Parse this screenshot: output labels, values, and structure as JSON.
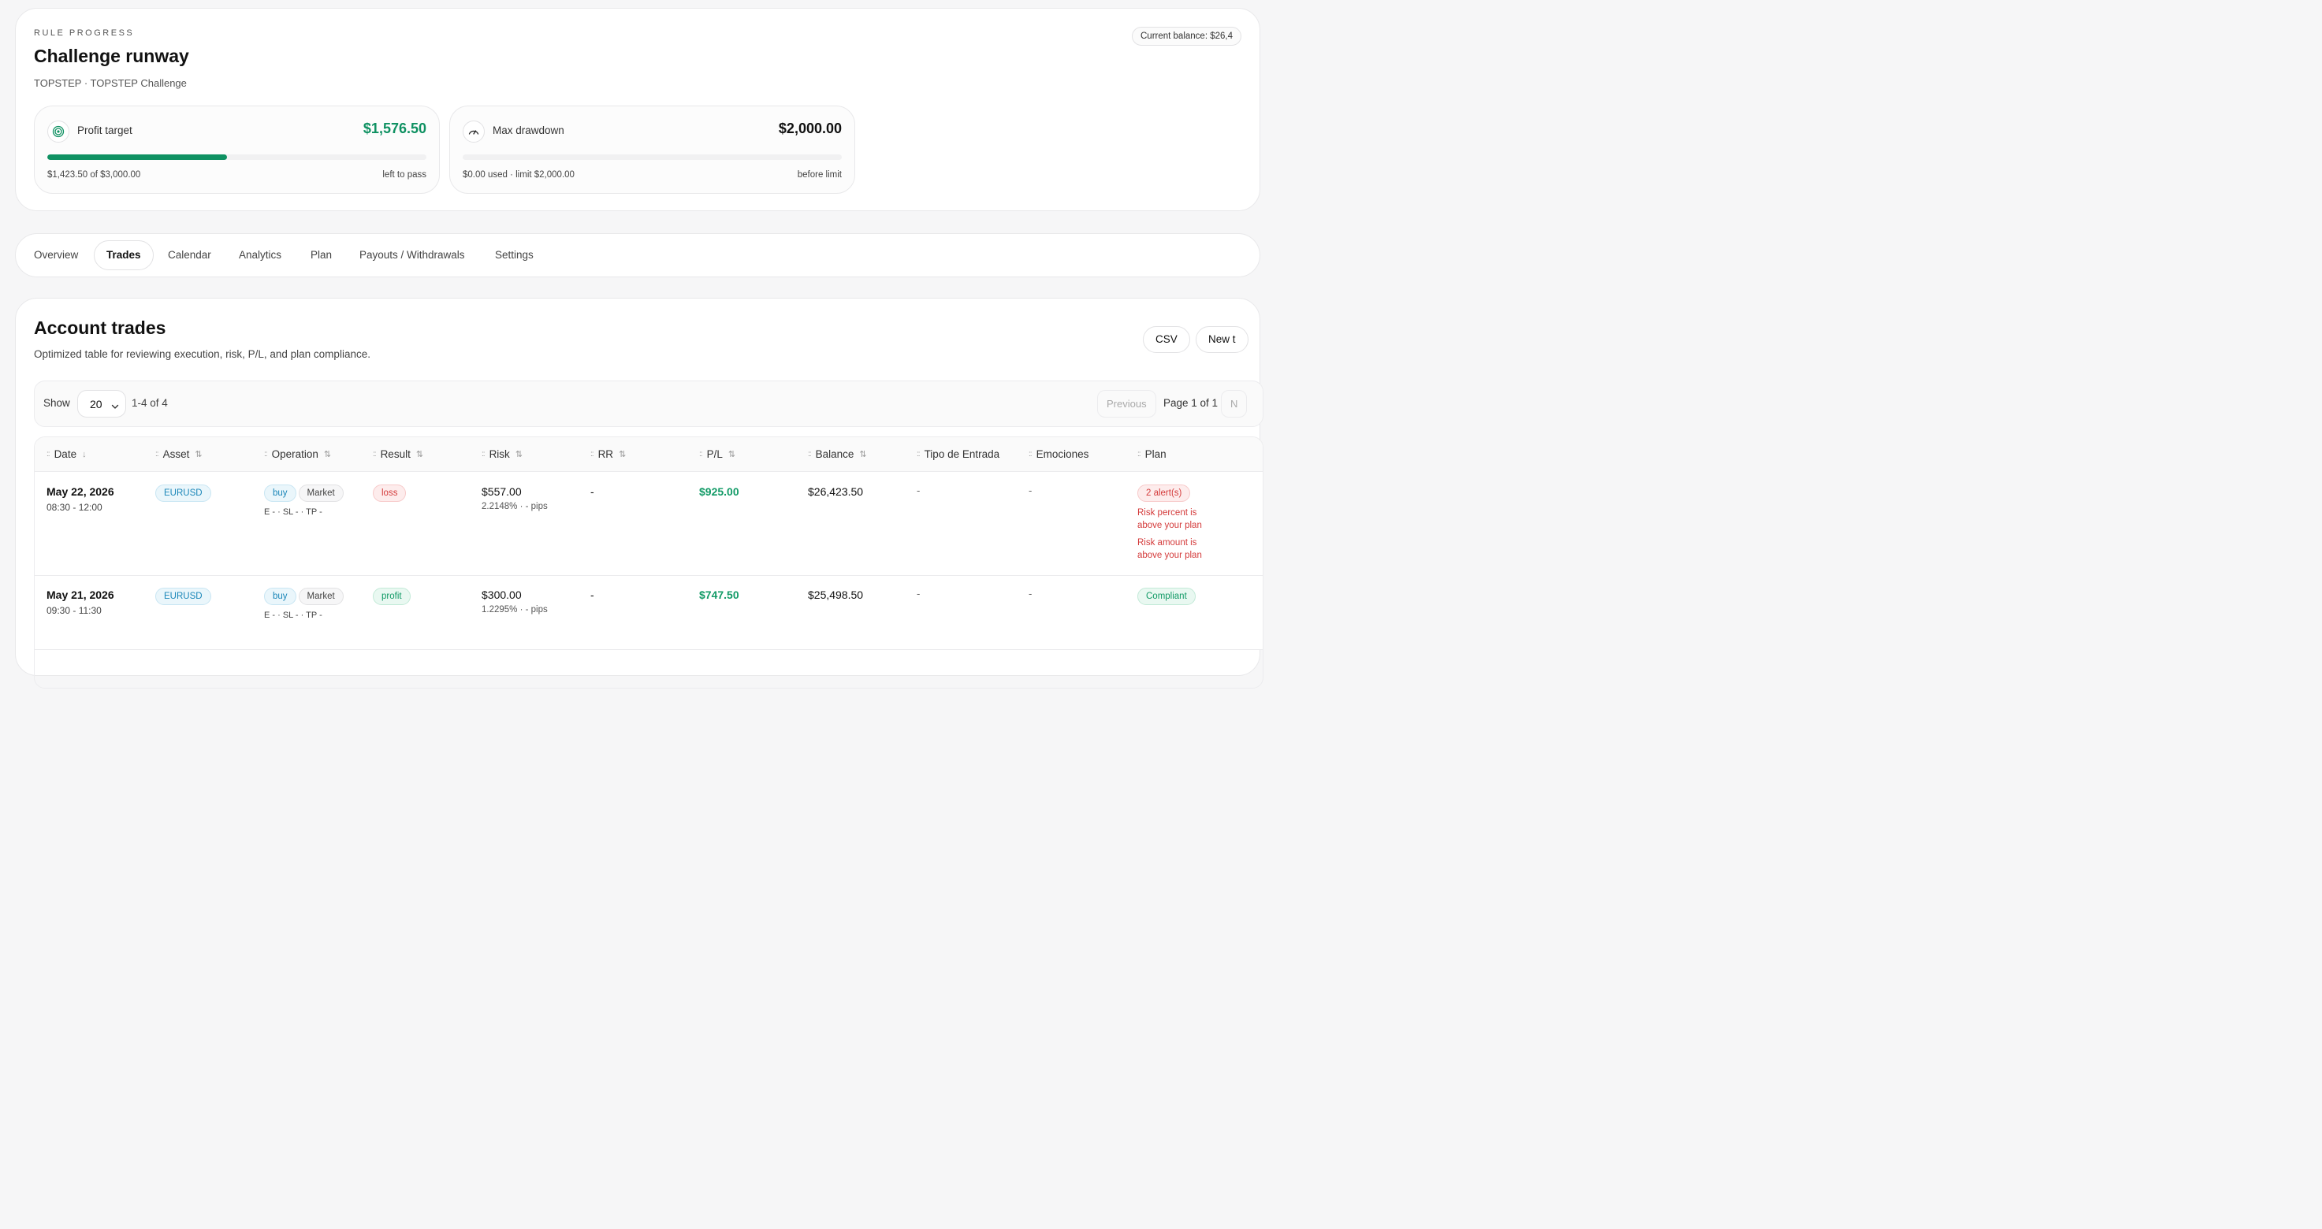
{
  "rule_progress": {
    "eyebrow": "RULE PROGRESS",
    "title": "Challenge runway",
    "subtitle": "TOPSTEP · TOPSTEP Challenge",
    "balance_pill": "Current balance: $26,4",
    "profit_target": {
      "label": "Profit target",
      "value": "$1,576.50",
      "progress": 0.4745,
      "footer_left": "$1,423.50 of $3,000.00",
      "footer_right": "left to pass",
      "icon": "target-icon",
      "color": "#0f9162"
    },
    "max_drawdown": {
      "label": "Max drawdown",
      "value": "$2,000.00",
      "progress": 0,
      "footer_left": "$0.00 used · limit $2,000.00",
      "footer_right": "before limit",
      "icon": "gauge-icon"
    }
  },
  "tabs": [
    {
      "label": "Overview",
      "active": false
    },
    {
      "label": "Trades",
      "active": true
    },
    {
      "label": "Calendar",
      "active": false
    },
    {
      "label": "Analytics",
      "active": false
    },
    {
      "label": "Plan",
      "active": false
    },
    {
      "label": "Payouts / Withdrawals",
      "active": false
    },
    {
      "label": "Settings",
      "active": false
    }
  ],
  "trades": {
    "title": "Account trades",
    "subtitle": "Optimized table for reviewing execution, risk, P/L, and plan compliance.",
    "csv_label": "CSV",
    "new_label": "New t",
    "toolbar": {
      "show_label": "Show",
      "page_size": "20",
      "range": "1-4 of 4",
      "previous": "Previous",
      "page_label": "Page 1 of 1",
      "next": "N"
    },
    "columns": {
      "date": "Date",
      "asset": "Asset",
      "operation": "Operation",
      "result": "Result",
      "risk": "Risk",
      "rr": "RR",
      "pl": "P/L",
      "balance": "Balance",
      "entry_type": "Tipo de Entrada",
      "emotions": "Emociones",
      "plan": "Plan"
    },
    "rows": [
      {
        "date": "May 22, 2026",
        "time": "08:30 - 12:00",
        "asset": "EURUSD",
        "side": "buy",
        "order_type": "Market",
        "levels": "E - · SL - · TP -",
        "result": "loss",
        "risk": "$557.00",
        "risk_detail": "2.2148% · - pips",
        "rr": "-",
        "pl": "$925.00",
        "balance": "$26,423.50",
        "entry_type": "-",
        "emotions": "-",
        "plan_badge": "2 alert(s)",
        "plan_alert_1": "Risk percent is above your plan",
        "plan_alert_2": "Risk amount is above your plan"
      },
      {
        "date": "May 21, 2026",
        "time": "09:30 - 11:30",
        "asset": "EURUSD",
        "side": "buy",
        "order_type": "Market",
        "levels": "E - · SL - · TP -",
        "result": "profit",
        "risk": "$300.00",
        "risk_detail": "1.2295% · - pips",
        "rr": "-",
        "pl": "$747.50",
        "balance": "$25,498.50",
        "entry_type": "-",
        "emotions": "-",
        "plan_badge": "Compliant"
      }
    ]
  }
}
